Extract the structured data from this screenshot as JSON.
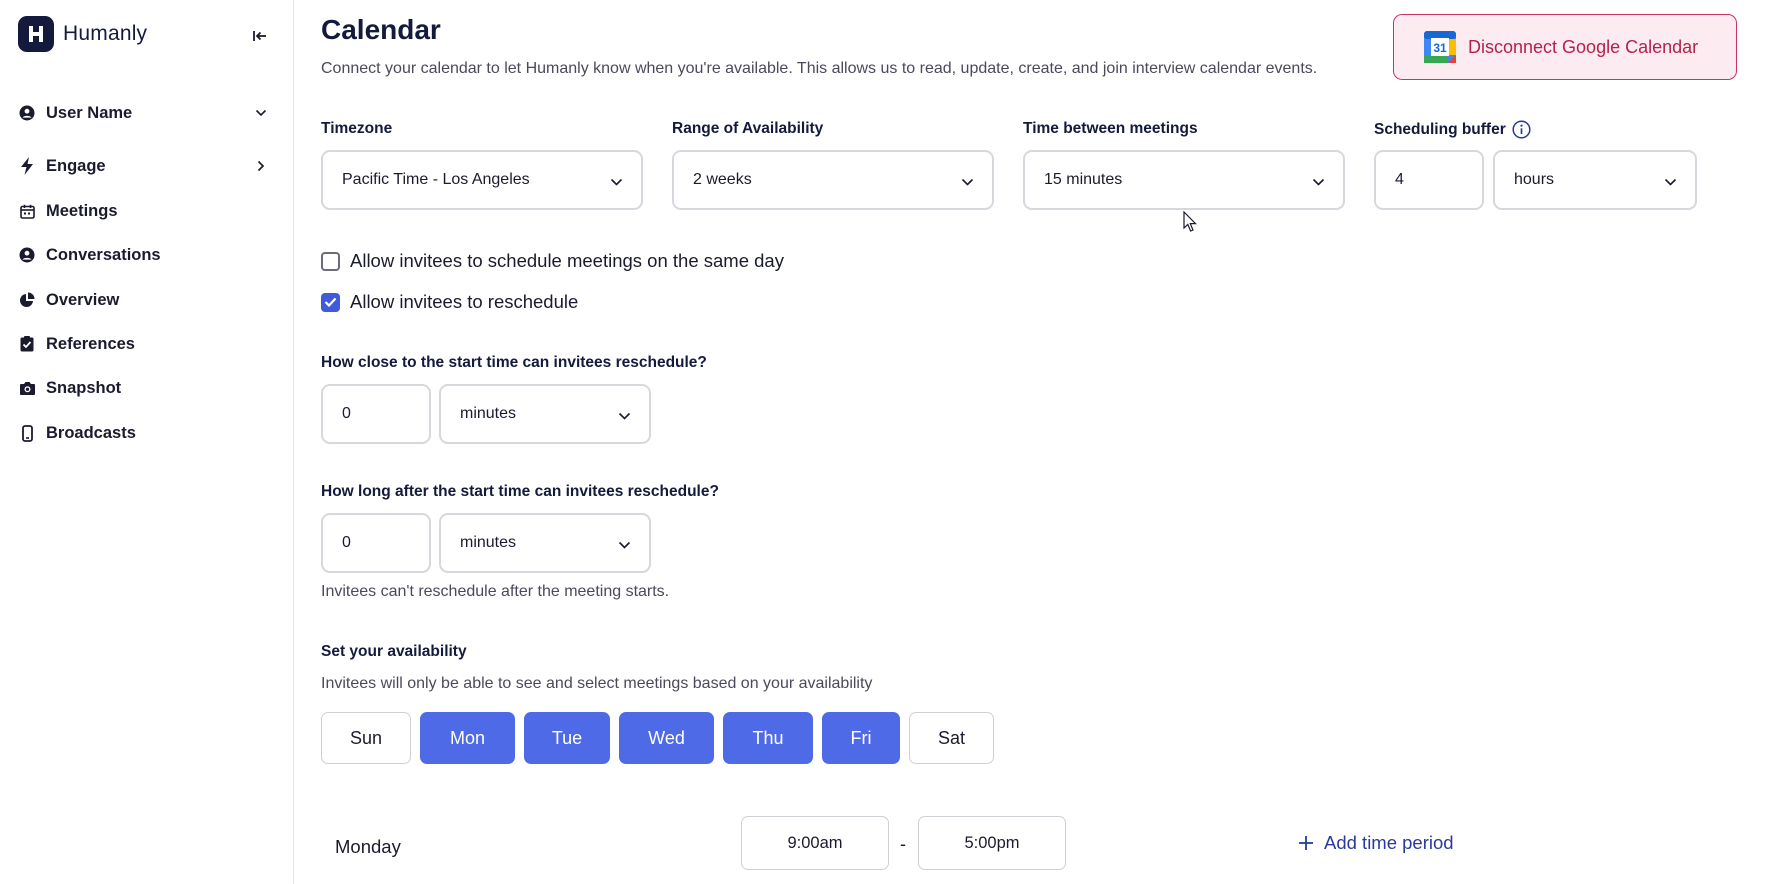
{
  "app": {
    "brand": "Humanly"
  },
  "sidebar": {
    "user": {
      "label": "User Name"
    },
    "items": [
      {
        "label": "Engage",
        "icon": "bolt-icon"
      },
      {
        "label": "Meetings",
        "icon": "calendar-icon"
      },
      {
        "label": "Conversations",
        "icon": "user-circle-icon"
      },
      {
        "label": "Overview",
        "icon": "pie-chart-icon"
      },
      {
        "label": "References",
        "icon": "clipboard-check-icon"
      },
      {
        "label": "Snapshot",
        "icon": "camera-icon"
      },
      {
        "label": "Broadcasts",
        "icon": "phone-icon"
      }
    ]
  },
  "page": {
    "title": "Calendar",
    "description": "Connect your calendar to let Humanly know when you're available. This allows us to read, update, create, and join interview calendar events.",
    "disconnect_button": "Disconnect Google Calendar",
    "gcal_icon_day": "31"
  },
  "settings": {
    "timezone": {
      "label": "Timezone",
      "value": "Pacific Time - Los Angeles"
    },
    "range": {
      "label": "Range of Availability",
      "value": "2 weeks"
    },
    "between": {
      "label": "Time between meetings",
      "value": "15 minutes"
    },
    "buffer": {
      "label": "Scheduling buffer",
      "amount": "4",
      "unit": "hours"
    }
  },
  "options": {
    "same_day": {
      "label": "Allow invitees to schedule meetings on the same day",
      "checked": false
    },
    "reschedule": {
      "label": "Allow invitees to reschedule",
      "checked": true
    }
  },
  "reschedule_before": {
    "label": "How close to the start time can invitees reschedule?",
    "amount": "0",
    "unit": "minutes"
  },
  "reschedule_after": {
    "label": "How long after the start time can invitees reschedule?",
    "amount": "0",
    "unit": "minutes",
    "helper": "Invitees can't reschedule after the meeting starts."
  },
  "availability": {
    "title": "Set your availability",
    "helper": "Invitees will only be able to see and select meetings based on your availability",
    "days": [
      {
        "label": "Sun",
        "selected": false
      },
      {
        "label": "Mon",
        "selected": true
      },
      {
        "label": "Tue",
        "selected": true
      },
      {
        "label": "Wed",
        "selected": true
      },
      {
        "label": "Thu",
        "selected": true
      },
      {
        "label": "Fri",
        "selected": true
      },
      {
        "label": "Sat",
        "selected": false
      }
    ],
    "schedule": [
      {
        "day": "Monday",
        "start": "9:00am",
        "separator": "-",
        "end": "5:00pm"
      }
    ],
    "add_period": "Add time period"
  },
  "colors": {
    "accent": "#4f6ae6",
    "brand_dark": "#141a3c",
    "danger": "#b3224d",
    "danger_bg": "#fcecf1"
  }
}
